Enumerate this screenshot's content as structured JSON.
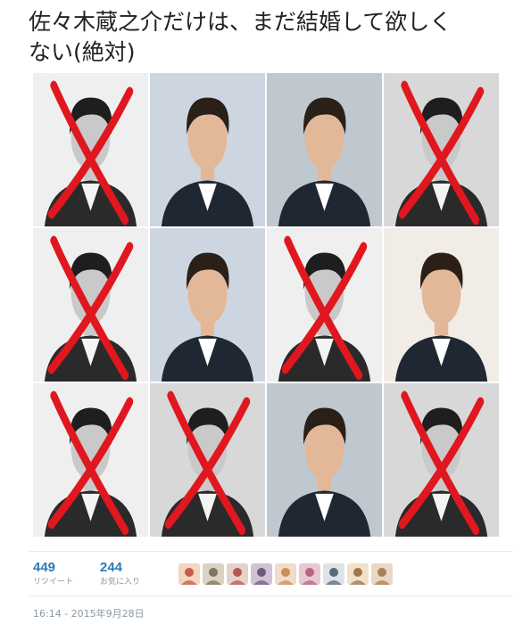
{
  "tweet": {
    "text_line1": "佐々木蔵之介だけは、まだ結婚して欲しく",
    "text_line2": "ない(絶対)"
  },
  "photos": [
    {
      "crossed": true,
      "tone": "bw"
    },
    {
      "crossed": false,
      "tone": "color"
    },
    {
      "crossed": false,
      "tone": "color"
    },
    {
      "crossed": true,
      "tone": "bw"
    },
    {
      "crossed": true,
      "tone": "bw"
    },
    {
      "crossed": false,
      "tone": "color"
    },
    {
      "crossed": true,
      "tone": "bw"
    },
    {
      "crossed": false,
      "tone": "color"
    },
    {
      "crossed": true,
      "tone": "bw"
    },
    {
      "crossed": true,
      "tone": "bw"
    },
    {
      "crossed": false,
      "tone": "color"
    },
    {
      "crossed": true,
      "tone": "bw"
    }
  ],
  "stats": {
    "retweets": {
      "count": "449",
      "label": "リツイート"
    },
    "favorites": {
      "count": "244",
      "label": "お気に入り"
    }
  },
  "avatar_count": 9,
  "timestamp": "16:14 - 2015年9月28日",
  "colors": {
    "text": "#222222",
    "stat_count": "#2b7bb9",
    "muted": "#8899a6",
    "cross": "#e0171f"
  }
}
